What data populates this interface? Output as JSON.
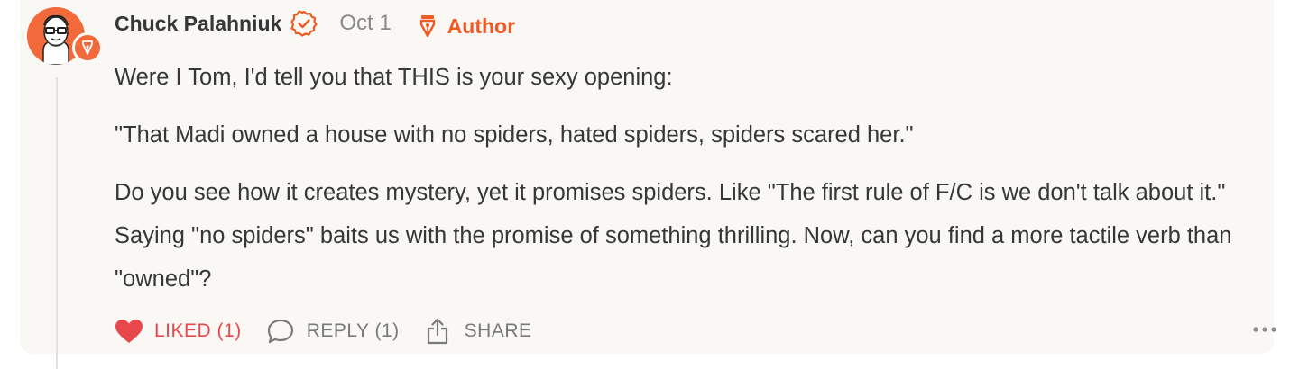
{
  "comment": {
    "author_name": "Chuck Palahniuk",
    "date": "Oct 1",
    "author_tag": "Author",
    "body": [
      "Were I Tom, I'd tell you that THIS is your sexy opening:",
      "\"That Madi owned a house with no spiders, hated spiders, spiders scared her.\"",
      "Do you see how it creates mystery, yet it promises spiders. Like \"The first rule of F/C is we don't talk about it.\" Saying \"no spiders\" baits us with the promise of something thrilling. Now, can you find a more tactile verb than \"owned\"?"
    ]
  },
  "actions": {
    "like_label": "LIKED (1)",
    "reply_label": "REPLY (1)",
    "share_label": "SHARE"
  },
  "icons": {
    "avatar": "author-avatar",
    "author_badge": "pen-nib-icon",
    "verified": "verified-check-icon",
    "author_tag": "pen-nib-icon",
    "like": "heart-icon",
    "reply": "speech-bubble-icon",
    "share": "share-icon",
    "more": "ellipsis-icon"
  },
  "colors": {
    "accent": "#f05a23",
    "liked": "#e8484c",
    "card_bg": "#faf8f5",
    "muted": "#7a7a7a"
  }
}
